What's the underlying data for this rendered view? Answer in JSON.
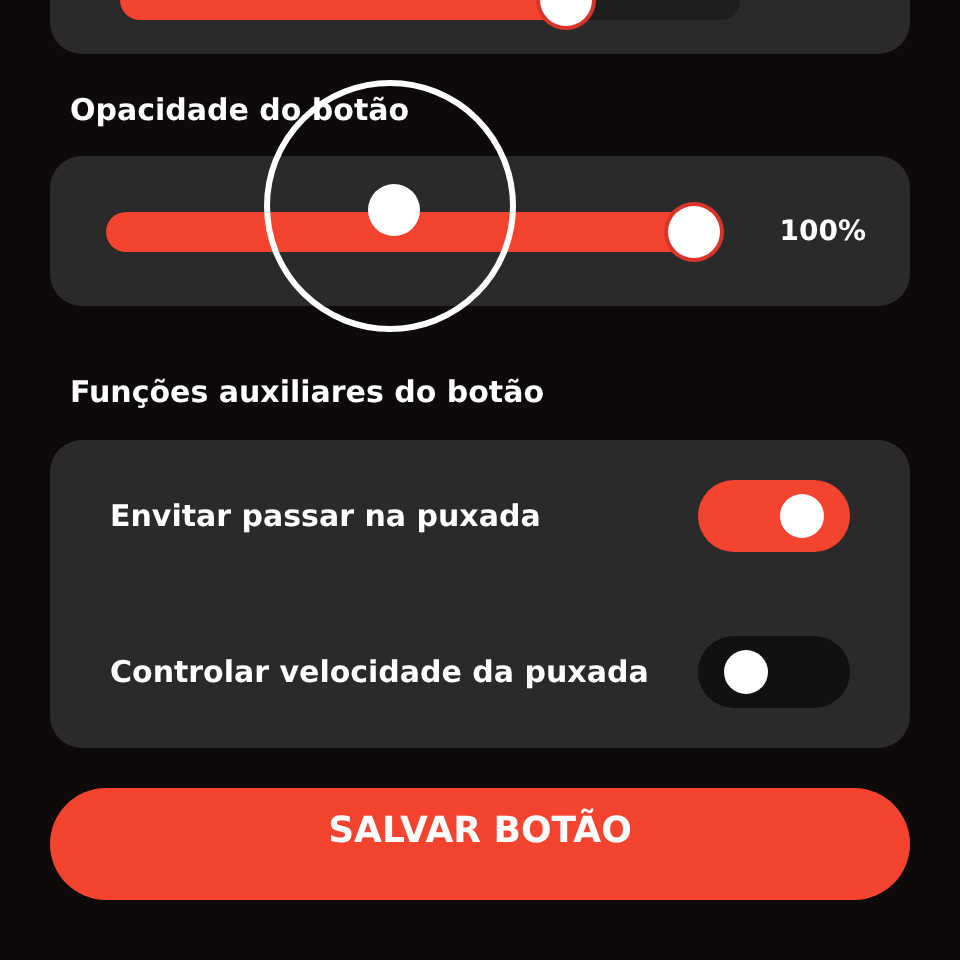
{
  "top_slider": {
    "level": 0.74
  },
  "opacity": {
    "heading": "Opacidade do botão",
    "level": 1.0,
    "reading": "100%"
  },
  "aux": {
    "heading": "Funções auxiliares do botão",
    "toggles": [
      {
        "label": "Envitar passar na puxada",
        "on": true
      },
      {
        "label": "Controlar velocidade da puxada",
        "on": false
      }
    ]
  },
  "save_button": {
    "label": "SALVAR BOTÃO"
  }
}
